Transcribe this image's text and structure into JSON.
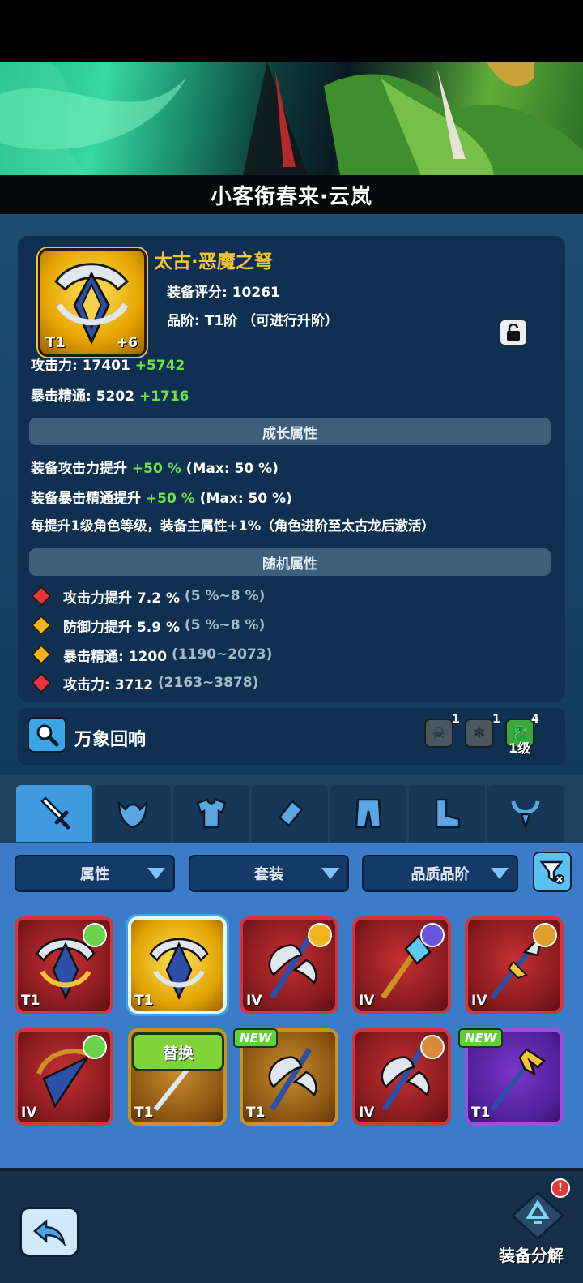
{
  "header": {
    "title": "小客衔春来·云岚"
  },
  "item": {
    "name": "太古·恶魔之弩",
    "tier": "T1",
    "level": "+6",
    "score_label": "装备评分: 10261",
    "grade_label": "品阶: T1阶 （可进行升阶）"
  },
  "main_stats": [
    {
      "label": "攻击力: 17401",
      "bonus": "+5742"
    },
    {
      "label": "暴击精通: 5202",
      "bonus": "+1716"
    }
  ],
  "growth": {
    "header": "成长属性",
    "lines": [
      {
        "prefix": "装备攻击力提升",
        "value": "+50 %",
        "suffix": "(Max: 50 %)"
      },
      {
        "prefix": "装备暴击精通提升",
        "value": "+50 %",
        "suffix": "(Max: 50 %)"
      },
      {
        "prefix": "每提升1级角色等级，装备主属性+1%（角色进阶至太古龙后激活）",
        "value": "",
        "suffix": ""
      }
    ]
  },
  "random": {
    "header": "随机属性",
    "rows": [
      {
        "gem": "red",
        "label": "攻击力提升 7.2 %",
        "range": "(5 %~8 %)"
      },
      {
        "gem": "gold",
        "label": "防御力提升 5.9 %",
        "range": "(5 %~8 %)"
      },
      {
        "gem": "gold",
        "label": "暴击精通: 1200",
        "range": "(1190~2073)"
      },
      {
        "gem": "red",
        "label": "攻击力: 3712",
        "range": "(2163~3878)"
      }
    ]
  },
  "echo": {
    "label": "万象回响",
    "slots": [
      {
        "count": "1",
        "icon": "skull-icon"
      },
      {
        "count": "1",
        "icon": "snowflake-icon"
      },
      {
        "count": "4",
        "icon": "dragon-icon",
        "level": "1级"
      }
    ]
  },
  "tabs": [
    "weapon",
    "helmet",
    "armor",
    "bracer",
    "pants",
    "boots",
    "necklace"
  ],
  "filters": {
    "attribute": "属性",
    "set": "套装",
    "quality": "品质品阶"
  },
  "cards_row1": [
    {
      "tier": "T1",
      "rarity": "red",
      "badge": "#6ad24a"
    },
    {
      "tier": "T1",
      "rarity": "selected",
      "badge": ""
    },
    {
      "tier": "IV",
      "rarity": "red",
      "badge": "#f3b51d"
    },
    {
      "tier": "IV",
      "rarity": "red",
      "badge": "#6a55e0"
    },
    {
      "tier": "IV",
      "rarity": "red",
      "badge": "#e0a02a"
    }
  ],
  "cards_row2": [
    {
      "tier": "IV",
      "rarity": "red",
      "badge": "#6ad24a"
    },
    {
      "tier": "T1",
      "rarity": "gold",
      "badge": ""
    },
    {
      "tier": "T1",
      "rarity": "gold",
      "badge": "",
      "new": "NEW"
    },
    {
      "tier": "IV",
      "rarity": "red",
      "badge": "#d98a3a"
    },
    {
      "tier": "T1",
      "rarity": "purple",
      "badge": "",
      "new": "NEW"
    }
  ],
  "replace_label": "替换",
  "footer": {
    "decompose_label": "装备分解",
    "alert": "!"
  },
  "colors": {
    "accent_gold": "#f6c438",
    "stat_green": "#6fe04a",
    "panel_bg": "#0f3050",
    "list_bg": "#3a7cc7"
  }
}
